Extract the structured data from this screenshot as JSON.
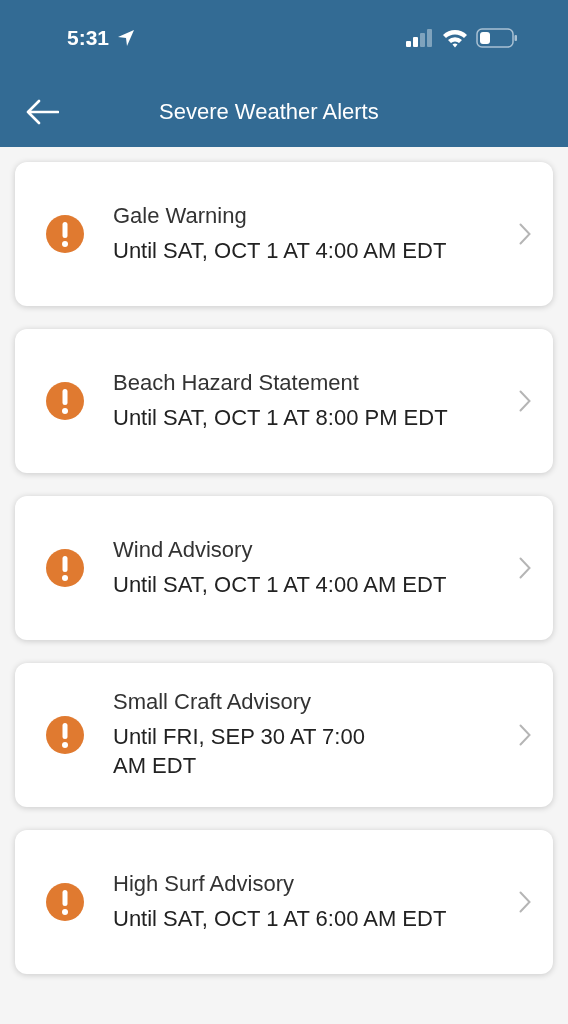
{
  "status_bar": {
    "time": "5:31"
  },
  "header": {
    "title": "Severe Weather Alerts"
  },
  "alerts": [
    {
      "title": "Gale Warning",
      "until": "Until SAT, OCT 1 AT 4:00 AM EDT"
    },
    {
      "title": "Beach Hazard Statement",
      "until": "Until SAT, OCT 1 AT 8:00 PM EDT"
    },
    {
      "title": "Wind Advisory",
      "until": "Until SAT, OCT 1 AT 4:00 AM EDT"
    },
    {
      "title": "Small Craft Advisory",
      "until": "Until FRI, SEP 30 AT 7:00\nAM EDT"
    },
    {
      "title": "High Surf Advisory",
      "until": "Until SAT, OCT 1 AT 6:00 AM EDT"
    }
  ]
}
